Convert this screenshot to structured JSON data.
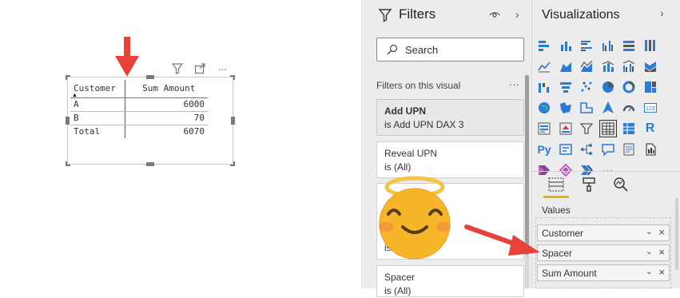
{
  "canvas": {
    "table": {
      "headers": [
        "Customer",
        "Sum Amount"
      ],
      "rows": [
        [
          "A",
          "6000"
        ],
        [
          "B",
          "70"
        ]
      ],
      "total": [
        "Total",
        "6070"
      ]
    },
    "header_icons": [
      "filter-icon",
      "focus-mode-icon",
      "more-options-icon"
    ],
    "more_glyph": "···"
  },
  "filters_pane": {
    "title": "Filters",
    "search_placeholder": "Search",
    "section_label": "Filters on this visual",
    "section_more": "···",
    "cards": [
      {
        "title": "Add UPN",
        "subtitle": "is Add UPN DAX 3",
        "active": true
      },
      {
        "title": "Reveal UPN",
        "subtitle": "is (All)",
        "active": false
      },
      {
        "title": "",
        "subtitle": "is (All)",
        "active": false
      },
      {
        "title": "Spacer",
        "subtitle": "is (All)",
        "active": false
      }
    ]
  },
  "viz_pane": {
    "title": "Visualizations",
    "values_label": "Values",
    "wells": [
      "Customer",
      "Spacer",
      "Sum Amount"
    ],
    "more_glyph": "···",
    "selected_visual": "table-visual-icon"
  },
  "colors": {
    "arrow_red": "#e8413a",
    "accent_yellow": "#e8b600",
    "powerbi_blue": "#2a7bd4",
    "emoji_face": "#f7b52a"
  }
}
